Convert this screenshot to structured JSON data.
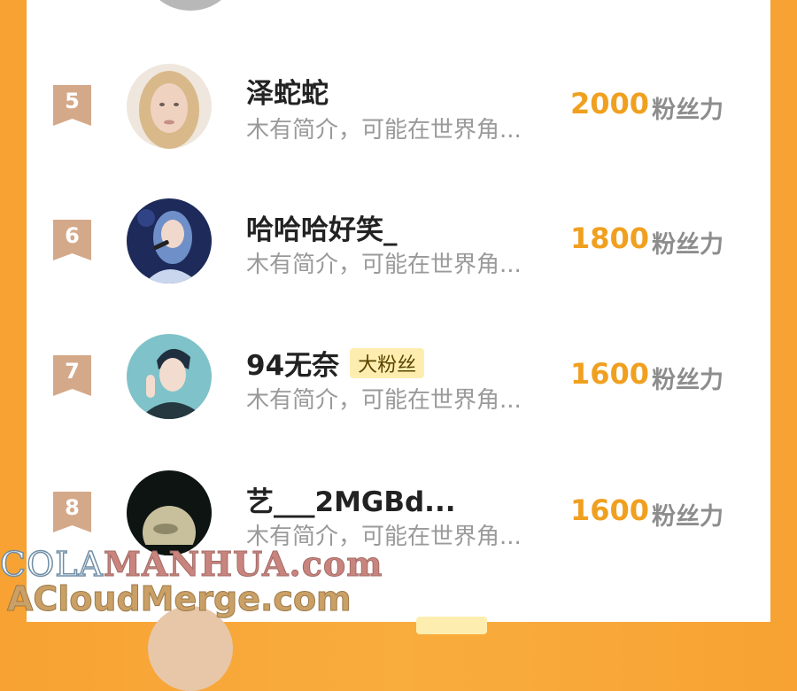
{
  "leaderboard": {
    "unit_label": "粉丝力",
    "rows": [
      {
        "rank": "5",
        "name": "泽蛇蛇",
        "tag": "",
        "desc": "木有简介，可能在世界角...",
        "score": "2000"
      },
      {
        "rank": "6",
        "name": "哈哈哈好笑_",
        "tag": "",
        "desc": "木有简介，可能在世界角...",
        "score": "1800"
      },
      {
        "rank": "7",
        "name": "94无奈",
        "tag": "大粉丝",
        "desc": "木有简介，可能在世界角...",
        "score": "1600"
      },
      {
        "rank": "8",
        "name": "艺___2MGBd...",
        "tag": "",
        "desc": "木有简介，可能在世界角...",
        "score": "1600"
      }
    ]
  },
  "watermark": {
    "line1_prefix": "COLA",
    "line1_suffix": "MANHUA.com",
    "line2": "ACloudMerge.com"
  },
  "colors": {
    "background": "#f7a233",
    "card": "#ffffff",
    "score": "#f0a020",
    "rank_badge": "#d4a98a",
    "tag_bg": "#fdeeb0"
  }
}
